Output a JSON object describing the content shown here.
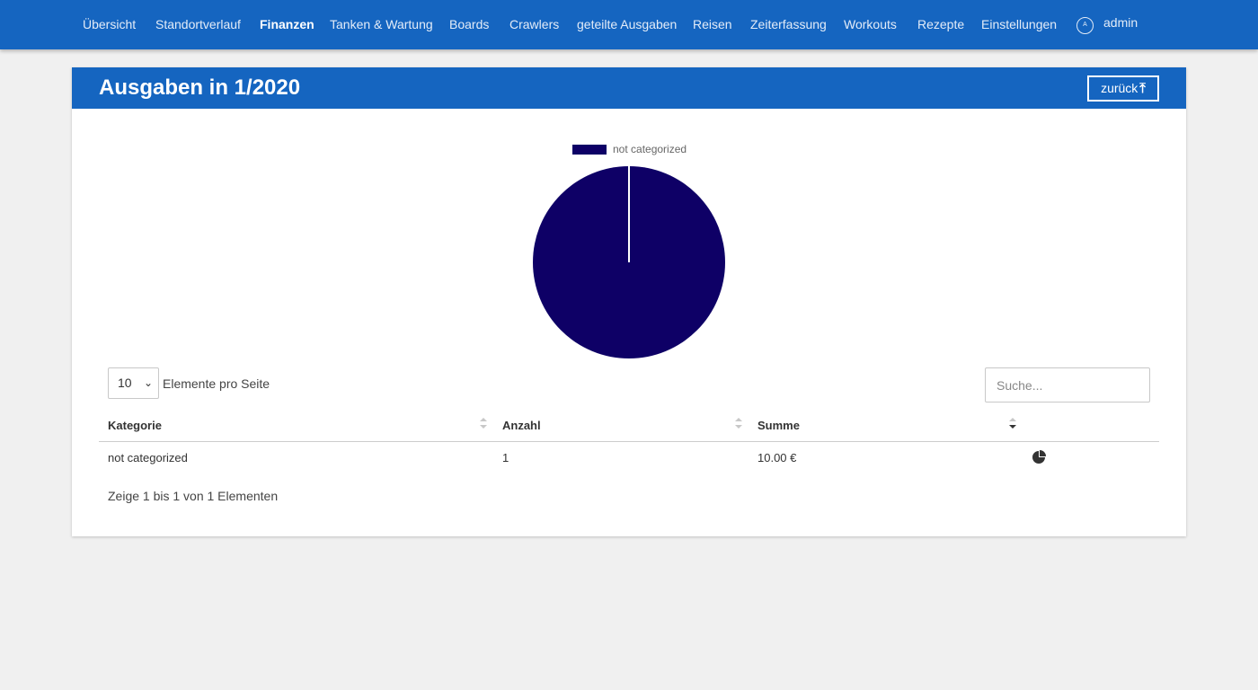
{
  "nav": {
    "items": [
      {
        "label": "Übersicht",
        "active": false
      },
      {
        "label": "Standortverlauf",
        "active": false
      },
      {
        "label": "Finanzen",
        "active": true
      },
      {
        "label": "Tanken & Wartung",
        "active": false
      },
      {
        "label": "Boards",
        "active": false
      },
      {
        "label": "Crawlers",
        "active": false
      },
      {
        "label": "geteilte Ausgaben",
        "active": false
      },
      {
        "label": "Reisen",
        "active": false
      },
      {
        "label": "Zeiterfassung",
        "active": false
      },
      {
        "label": "Workouts",
        "active": false
      },
      {
        "label": "Rezepte",
        "active": false
      },
      {
        "label": "Einstellungen",
        "active": false
      }
    ],
    "user_avatar": "A",
    "user_name": "admin",
    "bg_color": "#1565c0"
  },
  "card": {
    "title": "Ausgaben in 1/2020",
    "back_label": "zurück",
    "back_icon": "arrow-up-icon"
  },
  "chart_data": {
    "type": "pie",
    "categories": [
      "not categorized"
    ],
    "values": [
      10.0
    ],
    "colors": [
      "#0e0066"
    ],
    "legend": [
      "not categorized"
    ],
    "legend_position": "top"
  },
  "table": {
    "page_size": "10",
    "page_size_label": "Elemente pro Seite",
    "search_placeholder": "Suche...",
    "columns": [
      "Kategorie",
      "Anzahl",
      "Summe"
    ],
    "rows": [
      {
        "kategorie": "not categorized",
        "anzahl": "1",
        "summe": "10.00 €",
        "action_icon": "pie-chart-icon"
      }
    ],
    "info": "Zeige 1 bis 1 von 1 Elementen"
  }
}
